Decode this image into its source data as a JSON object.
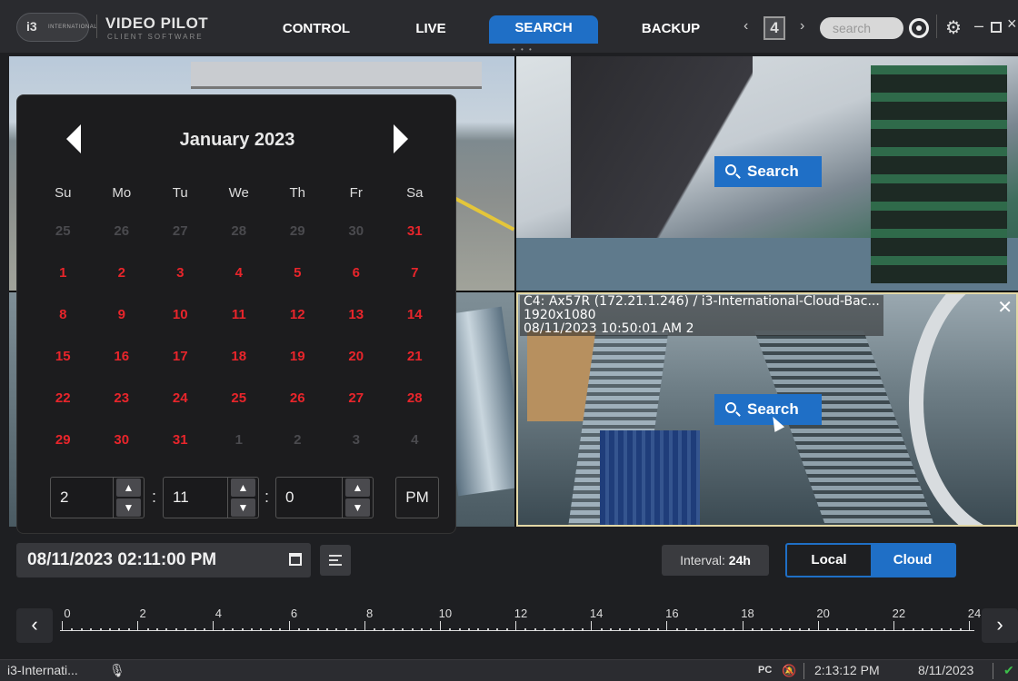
{
  "app": {
    "name": "VIDEO PILOT",
    "subtitle": "CLIENT SOFTWARE",
    "logo_text": "i3",
    "logo_sub": "INTERNATIONAL"
  },
  "nav": {
    "tabs": [
      {
        "label": "CONTROL",
        "active": false
      },
      {
        "label": "LIVE",
        "active": false
      },
      {
        "label": "SEARCH",
        "active": true
      },
      {
        "label": "BACKUP",
        "active": false
      }
    ],
    "page_dots": "• • •"
  },
  "toolbar": {
    "layout_value": "4",
    "search_placeholder": "search",
    "accent_color": "#1f6fc6"
  },
  "cameras": {
    "active_info_line1": "C4: Ax57R (172.21.1.246) / i3-International-Cloud-Bac...",
    "active_info_line2": "1920x1080",
    "active_info_line3": "08/11/2023 10:50:01 AM 2",
    "search_label": "Search"
  },
  "calendar": {
    "month_label": "January 2023",
    "weekdays": [
      "Su",
      "Mo",
      "Tu",
      "We",
      "Th",
      "Fr",
      "Sa"
    ],
    "weeks": [
      [
        {
          "d": "25",
          "s": "gray"
        },
        {
          "d": "26",
          "s": "gray"
        },
        {
          "d": "27",
          "s": "gray"
        },
        {
          "d": "28",
          "s": "gray"
        },
        {
          "d": "29",
          "s": "gray"
        },
        {
          "d": "30",
          "s": "gray"
        },
        {
          "d": "31",
          "s": "red"
        }
      ],
      [
        {
          "d": "1",
          "s": "red"
        },
        {
          "d": "2",
          "s": "red"
        },
        {
          "d": "3",
          "s": "red"
        },
        {
          "d": "4",
          "s": "red"
        },
        {
          "d": "5",
          "s": "red"
        },
        {
          "d": "6",
          "s": "red"
        },
        {
          "d": "7",
          "s": "red"
        }
      ],
      [
        {
          "d": "8",
          "s": "red"
        },
        {
          "d": "9",
          "s": "red"
        },
        {
          "d": "10",
          "s": "red"
        },
        {
          "d": "11",
          "s": "red"
        },
        {
          "d": "12",
          "s": "red"
        },
        {
          "d": "13",
          "s": "red"
        },
        {
          "d": "14",
          "s": "red"
        }
      ],
      [
        {
          "d": "15",
          "s": "red"
        },
        {
          "d": "16",
          "s": "red"
        },
        {
          "d": "17",
          "s": "red"
        },
        {
          "d": "18",
          "s": "red"
        },
        {
          "d": "19",
          "s": "red"
        },
        {
          "d": "20",
          "s": "red"
        },
        {
          "d": "21",
          "s": "red"
        }
      ],
      [
        {
          "d": "22",
          "s": "red"
        },
        {
          "d": "23",
          "s": "red"
        },
        {
          "d": "24",
          "s": "red"
        },
        {
          "d": "25",
          "s": "red"
        },
        {
          "d": "26",
          "s": "red"
        },
        {
          "d": "27",
          "s": "red"
        },
        {
          "d": "28",
          "s": "red"
        }
      ],
      [
        {
          "d": "29",
          "s": "red"
        },
        {
          "d": "30",
          "s": "red"
        },
        {
          "d": "31",
          "s": "red"
        },
        {
          "d": "1",
          "s": "gray"
        },
        {
          "d": "2",
          "s": "gray"
        },
        {
          "d": "3",
          "s": "gray"
        },
        {
          "d": "4",
          "s": "gray"
        }
      ]
    ],
    "hour": "2",
    "minute": "11",
    "second": "0",
    "ampm": "PM",
    "date_color": "#e8252b"
  },
  "controls": {
    "datetime": "08/11/2023 02:11:00 PM",
    "interval_label": "Interval:",
    "interval_value": "24h",
    "source_local": "Local",
    "source_cloud": "Cloud",
    "source_selected": "Cloud"
  },
  "timeline": {
    "labels": [
      "0",
      "2",
      "4",
      "6",
      "8",
      "10",
      "12",
      "14",
      "16",
      "18",
      "20",
      "22",
      "24"
    ]
  },
  "statusbar": {
    "server_name": "i3-Internati...",
    "pc_label": "PC",
    "time": "2:13:12 PM",
    "date": "8/11/2023",
    "connected_color": "#3cbf4a"
  }
}
